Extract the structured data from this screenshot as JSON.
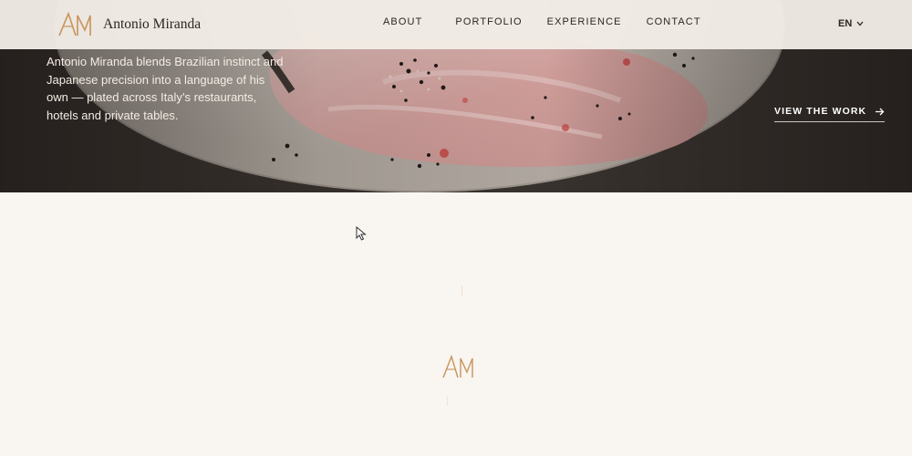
{
  "brand": {
    "name": "Antonio Miranda",
    "logo_icon": "am-monogram-icon",
    "accent": "#c8945a"
  },
  "nav": {
    "items": [
      {
        "label": "ABOUT"
      },
      {
        "label": "PORTFOLIO"
      },
      {
        "label": "EXPERIENCE"
      },
      {
        "label": "CONTACT"
      }
    ],
    "language": "EN"
  },
  "hero": {
    "copy": "Antonio Miranda blends Brazilian instinct and Japanese precision into a language of his own — plated across Italy’s restaurants, hotels and private tables.",
    "cta_label": "VIEW THE WORK",
    "cta_icon": "arrow-right-icon"
  },
  "loader": {
    "icon": "am-monogram-icon"
  }
}
